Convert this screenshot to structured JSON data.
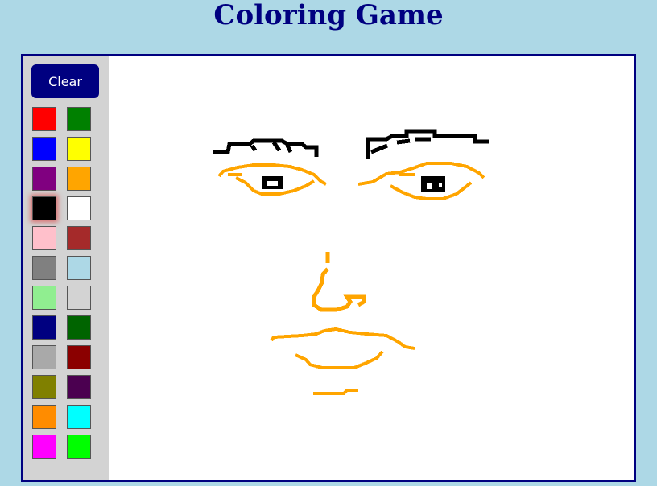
{
  "title": "Coloring Game",
  "toolbar": {
    "clear_label": "Clear"
  },
  "palette": [
    {
      "name": "red",
      "color": "#ff0000"
    },
    {
      "name": "green",
      "color": "#008000"
    },
    {
      "name": "blue",
      "color": "#0000ff"
    },
    {
      "name": "yellow",
      "color": "#ffff00"
    },
    {
      "name": "purple",
      "color": "#800080"
    },
    {
      "name": "orange",
      "color": "#ffa500"
    },
    {
      "name": "black",
      "color": "#000000",
      "selected": true
    },
    {
      "name": "white",
      "color": "#ffffff"
    },
    {
      "name": "pink",
      "color": "#ffc0cb"
    },
    {
      "name": "brown",
      "color": "#a52a2a"
    },
    {
      "name": "gray",
      "color": "#808080"
    },
    {
      "name": "lightblue",
      "color": "#add8e6"
    },
    {
      "name": "lightgreen",
      "color": "#90ee90"
    },
    {
      "name": "lightgray",
      "color": "#d3d3d3"
    },
    {
      "name": "navy",
      "color": "#000080"
    },
    {
      "name": "darkgreen",
      "color": "#006400"
    },
    {
      "name": "darkgray",
      "color": "#a9a9a9"
    },
    {
      "name": "darkred",
      "color": "#8b0000"
    },
    {
      "name": "olive",
      "color": "#808000"
    },
    {
      "name": "darkpurple",
      "color": "#4b0050"
    },
    {
      "name": "darkorange",
      "color": "#ff8c00"
    },
    {
      "name": "cyan",
      "color": "#00ffff"
    },
    {
      "name": "magenta",
      "color": "#ff00ff"
    },
    {
      "name": "lime",
      "color": "#00ff00"
    }
  ],
  "drawing_colors": {
    "line": "#ffa500",
    "detail": "#000000"
  }
}
